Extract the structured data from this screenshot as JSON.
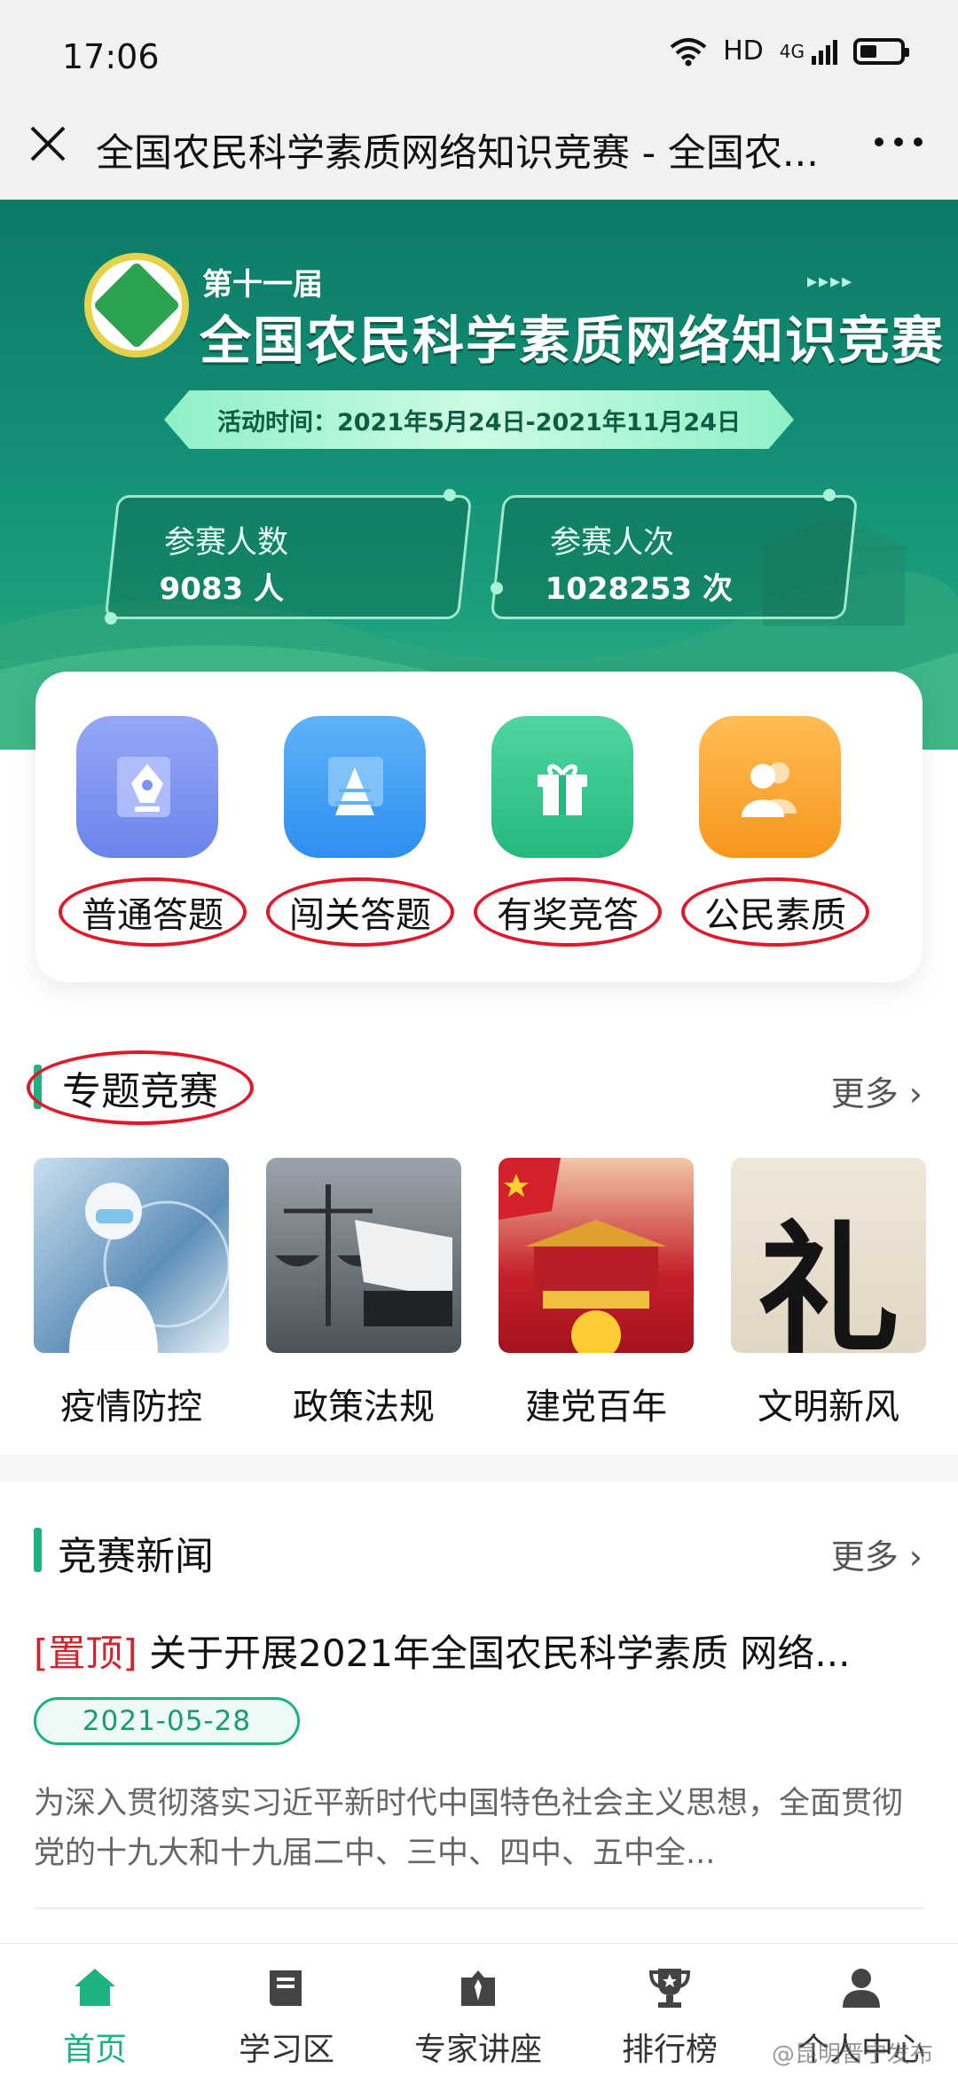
{
  "status_bar": {
    "time": "17:06",
    "network": "HD",
    "signal": "4G"
  },
  "nav": {
    "title": "全国农民科学素质网络知识竞赛 - 全国农..."
  },
  "banner": {
    "edition": "第十一届",
    "title": "全国农民科学素质网络知识竞赛",
    "date_range": "活动时间：2021年5月24日-2021年11月24日",
    "stats": [
      {
        "label": "参赛人数",
        "value": "9083 人"
      },
      {
        "label": "参赛人次",
        "value": "1028253 次"
      }
    ]
  },
  "actions": [
    {
      "label": "普通答题",
      "icon": "pen-nib-icon",
      "color": "#7b93f0"
    },
    {
      "label": "闯关答题",
      "icon": "pyramid-icon",
      "color": "#3a9bf3"
    },
    {
      "label": "有奖竞答",
      "icon": "gift-icon",
      "color": "#2fc48a"
    },
    {
      "label": "公民素质",
      "icon": "people-icon",
      "color": "#f7a12d"
    }
  ],
  "topics_section": {
    "title": "专题竞赛",
    "more": "更多 ›",
    "items": [
      {
        "label": "疫情防控"
      },
      {
        "label": "政策法规"
      },
      {
        "label": "建党百年"
      },
      {
        "label": "文明新风",
        "glyph": "礼"
      }
    ]
  },
  "news_section": {
    "title": "竞赛新闻",
    "more": "更多 ›",
    "pin": "[置顶]",
    "headline": "关于开展2021年全国农民科学素质 网络...",
    "date": "2021-05-28",
    "summary": "为深入贯彻落实习近平新时代中国特色社会主义思想，全面贯彻党的十九大和十九届二中、三中、四中、五中全..."
  },
  "tabs": [
    {
      "label": "首页",
      "icon": "home-icon",
      "active": true
    },
    {
      "label": "学习区",
      "icon": "book-icon"
    },
    {
      "label": "专家讲座",
      "icon": "expert-icon"
    },
    {
      "label": "排行榜",
      "icon": "trophy-icon"
    },
    {
      "label": "个人中心",
      "icon": "user-icon"
    }
  ],
  "watermark": "@昆明晋宁发布",
  "colors": {
    "accent": "#1db380",
    "annotation": "#e0182a",
    "banner": "#138f76"
  }
}
